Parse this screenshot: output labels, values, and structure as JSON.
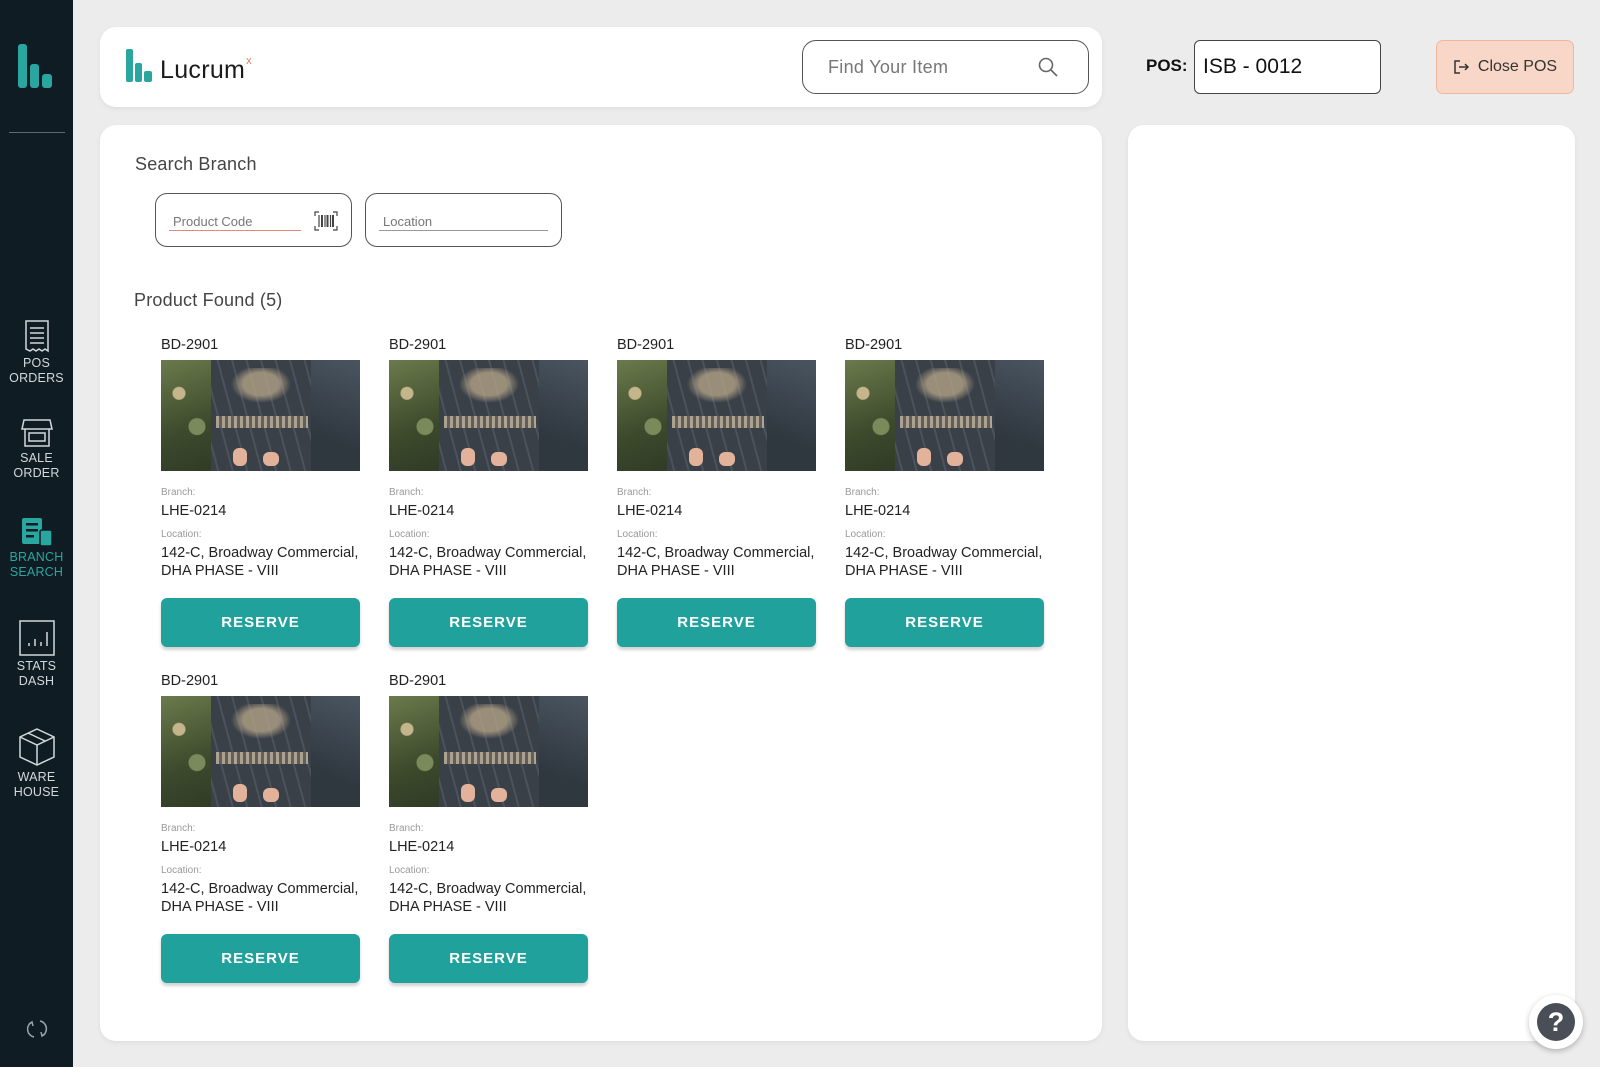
{
  "sidebar": {
    "items": [
      {
        "label": "POS\nORDERS",
        "icon": "pos-orders-icon",
        "active": false
      },
      {
        "label": "SALE\nORDER",
        "icon": "store-icon",
        "active": false
      },
      {
        "label": "BRANCH\nSEARCH",
        "icon": "branch-search-icon",
        "active": true
      },
      {
        "label": "STATS\nDASH",
        "icon": "stats-chart-icon",
        "active": false
      },
      {
        "label": "WARE\nHOUSE",
        "icon": "box-icon",
        "active": false
      }
    ],
    "accent_color": "#2aa6a0",
    "background_color": "#0f1c24"
  },
  "header": {
    "brand_name": "Lucrum",
    "brand_superscript": "x",
    "search_placeholder": "Find Your Item",
    "pos_label": "POS:",
    "pos_value": "ISB - 0012",
    "close_pos_label": "Close POS"
  },
  "main": {
    "search_title": "Search Branch",
    "product_code_placeholder": "Product Code",
    "location_placeholder": "Location",
    "results_title": "Product Found (5)",
    "products": [
      {
        "code": "BD-2901",
        "branch_label": "Branch:",
        "branch": "LHE-0214",
        "location_label": "Location:",
        "location_line1": "142-C, Broadway Commercial,",
        "location_line2": "DHA PHASE - VIII",
        "button": "RESERVE"
      },
      {
        "code": "BD-2901",
        "branch_label": "Branch:",
        "branch": "LHE-0214",
        "location_label": "Location:",
        "location_line1": "142-C, Broadway Commercial,",
        "location_line2": "DHA PHASE - VIII",
        "button": "RESERVE"
      },
      {
        "code": "BD-2901",
        "branch_label": "Branch:",
        "branch": "LHE-0214",
        "location_label": "Location:",
        "location_line1": "142-C, Broadway Commercial,",
        "location_line2": "DHA PHASE - VIII",
        "button": "RESERVE"
      },
      {
        "code": "BD-2901",
        "branch_label": "Branch:",
        "branch": "LHE-0214",
        "location_label": "Location:",
        "location_line1": "142-C, Broadway Commercial,",
        "location_line2": "DHA PHASE - VIII",
        "button": "RESERVE"
      },
      {
        "code": "BD-2901",
        "branch_label": "Branch:",
        "branch": "LHE-0214",
        "location_label": "Location:",
        "location_line1": "142-C, Broadway Commercial,",
        "location_line2": "DHA PHASE - VIII",
        "button": "RESERVE"
      },
      {
        "code": "BD-2901",
        "branch_label": "Branch:",
        "branch": "LHE-0214",
        "location_label": "Location:",
        "location_line1": "142-C, Broadway Commercial,",
        "location_line2": "DHA PHASE - VIII",
        "button": "RESERVE"
      }
    ],
    "button_color": "#21a19c"
  },
  "help_label": "?"
}
